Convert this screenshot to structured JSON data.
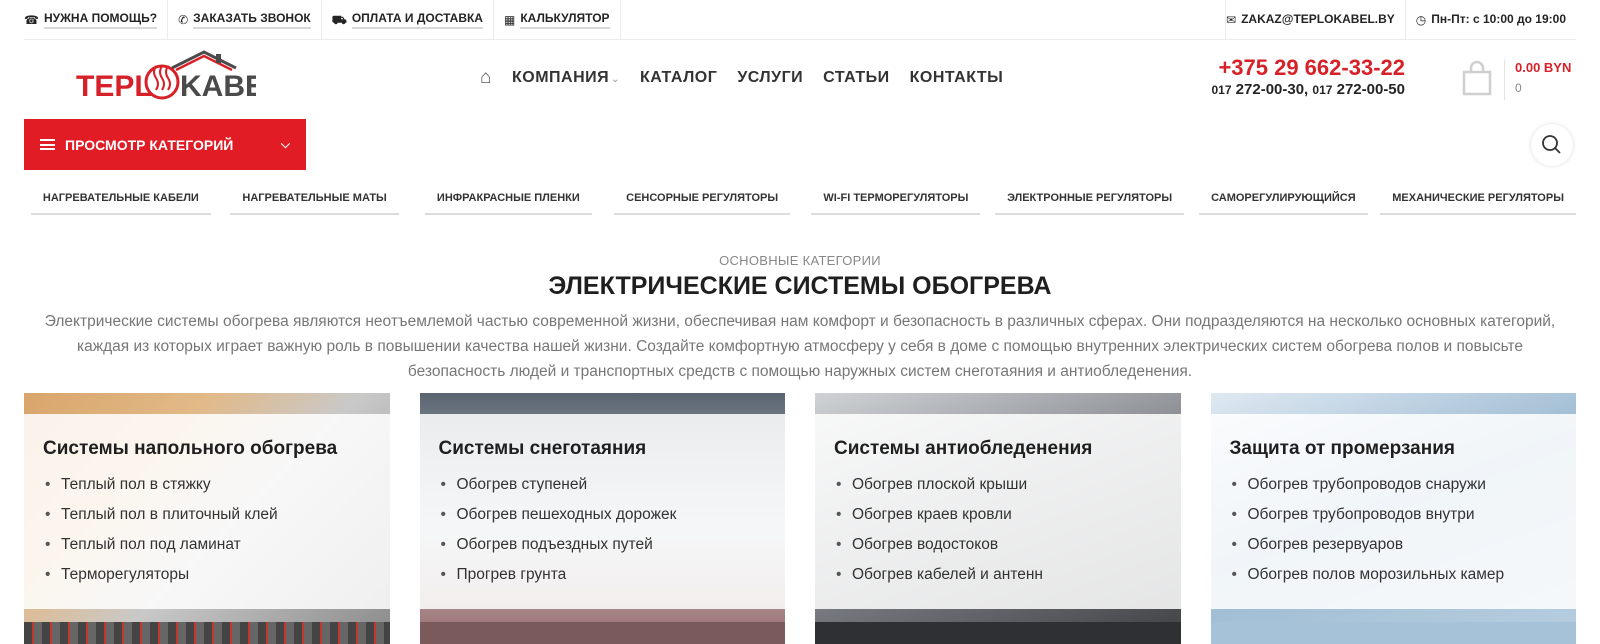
{
  "topbar": {
    "left": [
      {
        "icon": "help-icon",
        "glyph": "☎",
        "label": "НУЖНА ПОМОЩЬ?"
      },
      {
        "icon": "phone-icon",
        "glyph": "✆",
        "label": "ЗАКАЗАТЬ ЗВОНОК"
      },
      {
        "icon": "truck-icon",
        "glyph": "⛟",
        "label": "ОПЛАТА И ДОСТАВКА"
      },
      {
        "icon": "calculator-icon",
        "glyph": "▦",
        "label": "КАЛЬКУЛЯТОР"
      }
    ],
    "email": {
      "icon": "envelope-icon",
      "glyph": "✉",
      "label": "ZAKAZ@TEPLOKABEL.BY"
    },
    "hours": {
      "icon": "clock-icon",
      "glyph": "◷",
      "label": "Пн-Пт: с 10:00 до 19:00"
    }
  },
  "logo": {
    "text_left": "TEPL",
    "text_right": "KABEL",
    "accent": "#d62128",
    "dark": "#4a4a4a"
  },
  "nav": {
    "home_icon": "home-icon",
    "items": [
      "КОМПАНИЯ",
      "КАТАЛОГ",
      "УСЛУГИ",
      "СТАТЬИ",
      "КОНТАКТЫ"
    ]
  },
  "contacts": {
    "phone_main": "+375 29 662-33-22",
    "phone_pref1": "017",
    "phone_num1": "272-00-30,",
    "phone_pref2": "017",
    "phone_num2": "272-00-50"
  },
  "cart": {
    "icon": "shopping-bag-icon",
    "sum": "0.00 BYN",
    "count": "0"
  },
  "categories_button": {
    "label": "ПРОСМОТР КАТЕГОРИЙ",
    "icon": "chevron-down-icon",
    "color": "#e11c24"
  },
  "search": {
    "icon": "search-icon"
  },
  "subnav": [
    "НАГРЕВАТЕЛЬНЫЕ КАБЕЛИ",
    "НАГРЕВАТЕЛЬНЫЕ МАТЫ",
    "ИНФРАКРАСНЫЕ ПЛЕНКИ",
    "СЕНСОРНЫЕ РЕГУЛЯТОРЫ",
    "WI-FI ТЕРМОРЕГУЛЯТОРЫ",
    "ЭЛЕКТРОННЫЕ РЕГУЛЯТОРЫ",
    "САМОРЕГУЛИРУЮЩИЙСЯ",
    "МЕХАНИЧЕСКИЕ РЕГУЛЯТОРЫ"
  ],
  "intro": {
    "subtitle": "ОСНОВНЫЕ КАТЕГОРИИ",
    "title": "ЭЛЕКТРИЧЕСКИЕ СИСТЕМЫ ОБОГРЕВА",
    "text": "Электрические системы обогрева являются неотъемлемой частью современной жизни, обеспечивая нам комфорт и безопасность в различных сферах. Они подразделяются на несколько основных категорий, каждая из которых играет важную роль в повышении качества нашей жизни. Создайте комфортную атмосферу у себя в доме с помощью внутренних электрических систем обогрева полов и повысьте безопасность людей и транспортных средств с помощью наружных систем снеготаяния и антиобледенения."
  },
  "cards": [
    {
      "title": "Системы напольного обогрева",
      "items": [
        "Теплый пол в стяжку",
        "Теплый пол в плиточный клей",
        "Теплый пол под ламинат",
        "Терморегуляторы"
      ]
    },
    {
      "title": "Системы снеготаяния",
      "items": [
        "Обогрев ступеней",
        "Обогрев пешеходных дорожек",
        "Обогрев подъездных путей",
        "Прогрев грунта"
      ]
    },
    {
      "title": "Системы антиобледенения",
      "items": [
        "Обогрев плоской крыши",
        "Обогрев краев кровли",
        "Обогрев водостоков",
        "Обогрев кабелей и антенн"
      ]
    },
    {
      "title": "Защита от промерзания",
      "items": [
        "Обогрев трубопроводов снаружи",
        "Обогрев трубопроводов внутри",
        "Обогрев резервуаров",
        "Обогрев полов морозильных камер"
      ]
    }
  ]
}
